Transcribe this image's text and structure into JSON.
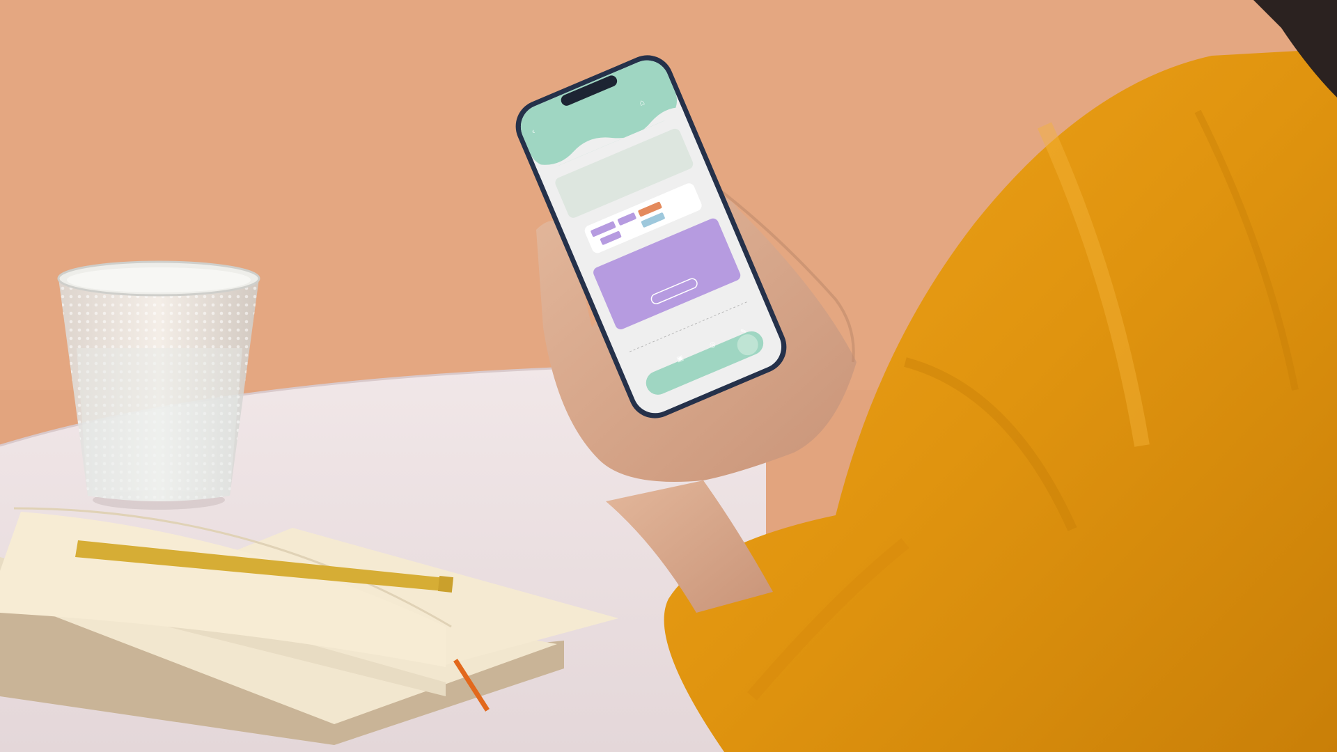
{
  "scene": {
    "description_free": true
  },
  "phone": {
    "status_time": "",
    "header_title": "",
    "sections": [
      {
        "kind": "info-card"
      },
      {
        "kind": "chip-row"
      },
      {
        "kind": "purple-card"
      },
      {
        "kind": "footer-note"
      }
    ],
    "tabbar_items": [
      "tab-1",
      "tab-2",
      "tab-3"
    ]
  },
  "colors": {
    "wall": "#e2a47e",
    "table": "#ebe1e2",
    "phone_header_green": "#9fd6c2",
    "phone_purple": "#b69be0",
    "shirt": "#e39a14"
  }
}
